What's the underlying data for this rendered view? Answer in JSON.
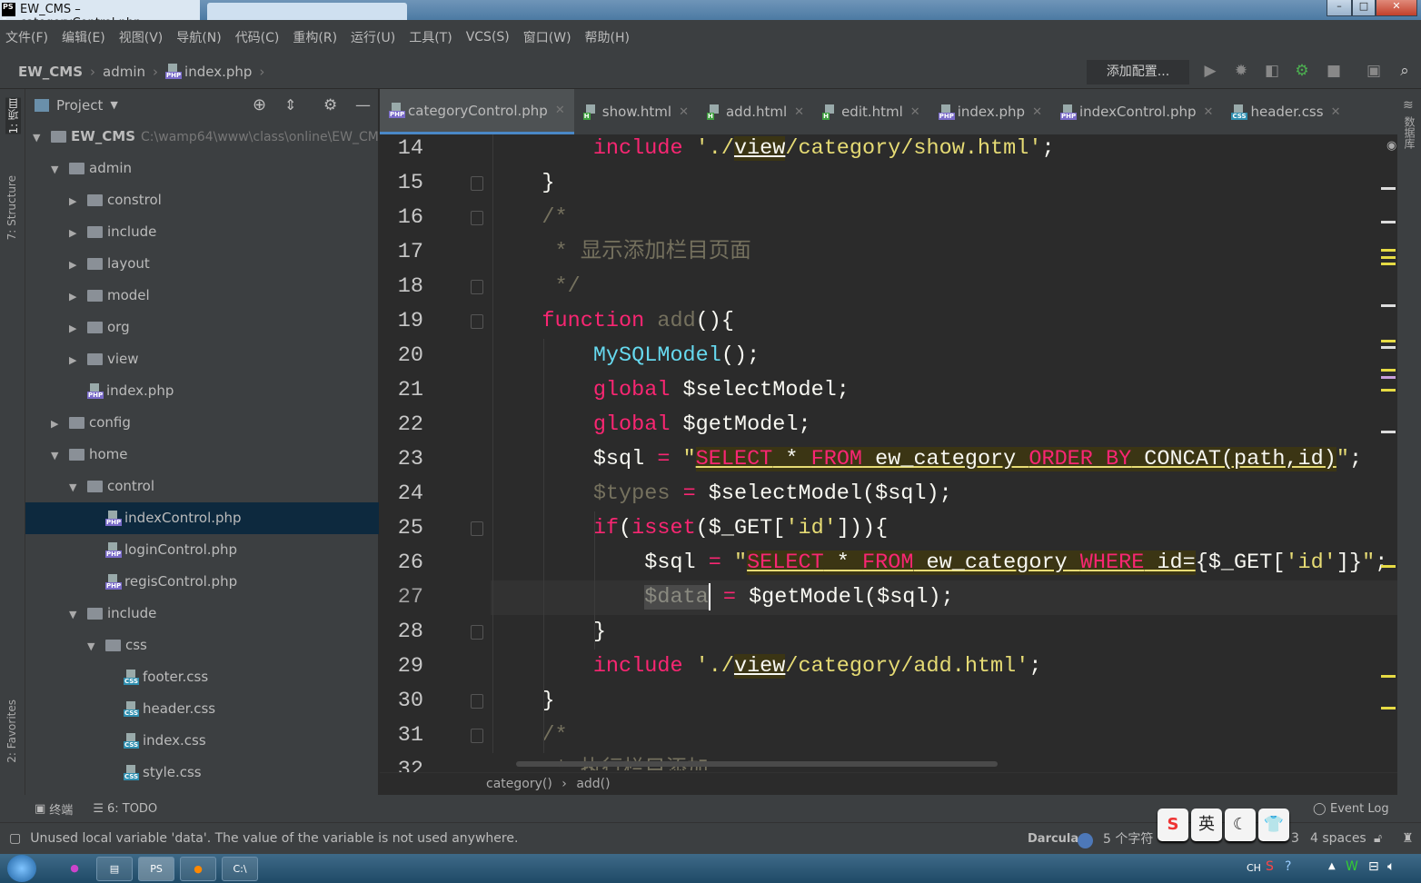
{
  "window": {
    "title": "EW_CMS – categoryControl.php",
    "controls": [
      "–",
      "□",
      "✕"
    ]
  },
  "menu": [
    "文件(F)",
    "编辑(E)",
    "视图(V)",
    "导航(N)",
    "代码(C)",
    "重构(R)",
    "运行(U)",
    "工具(T)",
    "VCS(S)",
    "窗口(W)",
    "帮助(H)"
  ],
  "breadcrumb": {
    "project": "EW_CMS",
    "folder": "admin",
    "file": "index.php"
  },
  "toolbar": {
    "run_config": "添加配置...",
    "icons": [
      "run-icon",
      "debug-icon",
      "coverage-icon",
      "profiler-icon",
      "stop-icon",
      "terminal-icon",
      "search-icon"
    ]
  },
  "left_stripe": {
    "project": "1: 项目",
    "structure": "7: Structure",
    "favorites": "2: Favorites"
  },
  "right_stripe": {
    "database": "数据库"
  },
  "project_panel": {
    "title": "Project",
    "tree": [
      {
        "name": "EW_CMS",
        "hint": "C:\\wamp64\\www\\class\\online\\EW_CM",
        "level": 0,
        "type": "folder",
        "state": "open",
        "bold": true
      },
      {
        "name": "admin",
        "level": 1,
        "type": "folder",
        "state": "open"
      },
      {
        "name": "constrol",
        "level": 2,
        "type": "folder",
        "state": "closed"
      },
      {
        "name": "include",
        "level": 2,
        "type": "folder",
        "state": "closed"
      },
      {
        "name": "layout",
        "level": 2,
        "type": "folder",
        "state": "closed"
      },
      {
        "name": "model",
        "level": 2,
        "type": "folder",
        "state": "closed"
      },
      {
        "name": "org",
        "level": 2,
        "type": "folder",
        "state": "closed"
      },
      {
        "name": "view",
        "level": 2,
        "type": "folder",
        "state": "closed"
      },
      {
        "name": "index.php",
        "level": 2,
        "type": "php"
      },
      {
        "name": "config",
        "level": 1,
        "type": "folder",
        "state": "closed"
      },
      {
        "name": "home",
        "level": 1,
        "type": "folder",
        "state": "open"
      },
      {
        "name": "control",
        "level": 2,
        "type": "folder",
        "state": "open"
      },
      {
        "name": "indexControl.php",
        "level": 3,
        "type": "php",
        "selected": true
      },
      {
        "name": "loginControl.php",
        "level": 3,
        "type": "php"
      },
      {
        "name": "regisControl.php",
        "level": 3,
        "type": "php"
      },
      {
        "name": "include",
        "level": 2,
        "type": "folder",
        "state": "open"
      },
      {
        "name": "css",
        "level": 3,
        "type": "folder",
        "state": "open"
      },
      {
        "name": "footer.css",
        "level": 4,
        "type": "css"
      },
      {
        "name": "header.css",
        "level": 4,
        "type": "css"
      },
      {
        "name": "index.css",
        "level": 4,
        "type": "css"
      },
      {
        "name": "style.css",
        "level": 4,
        "type": "css"
      }
    ]
  },
  "tabs": [
    {
      "label": "categoryControl.php",
      "type": "php",
      "active": true
    },
    {
      "label": "show.html",
      "type": "html"
    },
    {
      "label": "add.html",
      "type": "html"
    },
    {
      "label": "edit.html",
      "type": "html"
    },
    {
      "label": "index.php",
      "type": "php"
    },
    {
      "label": "indexControl.php",
      "type": "php"
    },
    {
      "label": "header.css",
      "type": "css"
    }
  ],
  "code": [
    {
      "n": "14",
      "t": [
        [
          "plain",
          "        "
        ],
        [
          "kw",
          "include"
        ],
        [
          "plain",
          " "
        ],
        [
          "str",
          "'./"
        ],
        [
          "link",
          "view"
        ],
        [
          "str",
          "/category/show.html'"
        ],
        [
          "plain",
          ";"
        ]
      ]
    },
    {
      "n": "15",
      "t": [
        [
          "plain",
          "    }"
        ]
      ]
    },
    {
      "n": "16",
      "t": [
        [
          "plain",
          "    "
        ],
        [
          "cmt",
          "/*"
        ]
      ]
    },
    {
      "n": "17",
      "t": [
        [
          "plain",
          "     "
        ],
        [
          "cmt",
          "* 显示添加栏目页面"
        ]
      ]
    },
    {
      "n": "18",
      "t": [
        [
          "plain",
          "     "
        ],
        [
          "cmt",
          "*/"
        ]
      ]
    },
    {
      "n": "19",
      "t": [
        [
          "plain",
          "    "
        ],
        [
          "kw",
          "function"
        ],
        [
          "plain",
          " "
        ],
        [
          "unused",
          "add"
        ],
        [
          "plain",
          "(){"
        ]
      ]
    },
    {
      "n": "20",
      "t": [
        [
          "plain",
          "        "
        ],
        [
          "fn",
          "MySQLModel"
        ],
        [
          "plain",
          "();"
        ]
      ]
    },
    {
      "n": "21",
      "t": [
        [
          "plain",
          "        "
        ],
        [
          "kw",
          "global"
        ],
        [
          "plain",
          " $selectModel;"
        ]
      ]
    },
    {
      "n": "22",
      "t": [
        [
          "plain",
          "        "
        ],
        [
          "kw",
          "global"
        ],
        [
          "plain",
          " $getModel;"
        ]
      ]
    },
    {
      "n": "23",
      "t": [
        [
          "plain",
          "        $sql "
        ],
        [
          "kw",
          "="
        ],
        [
          "plain",
          " "
        ],
        [
          "str",
          "\""
        ],
        [
          "sqlkw",
          "SELECT"
        ],
        [
          "sql",
          " * "
        ],
        [
          "sqlkw",
          "FROM"
        ],
        [
          "sql",
          " ew_category "
        ],
        [
          "sqlkw",
          "ORDER BY"
        ],
        [
          "sql",
          " CONCAT(path,id)"
        ],
        [
          "str",
          "\""
        ],
        [
          "plain",
          ";"
        ]
      ]
    },
    {
      "n": "24",
      "t": [
        [
          "plain",
          "        "
        ],
        [
          "unused",
          "$types"
        ],
        [
          "plain",
          " "
        ],
        [
          "kw",
          "="
        ],
        [
          "plain",
          " $selectModel($sql);"
        ]
      ]
    },
    {
      "n": "25",
      "t": [
        [
          "plain",
          "        "
        ],
        [
          "kw",
          "if"
        ],
        [
          "plain",
          "("
        ],
        [
          "kw",
          "isset"
        ],
        [
          "plain",
          "($_GET["
        ],
        [
          "str",
          "'id'"
        ],
        [
          "plain",
          "])){"
        ]
      ]
    },
    {
      "n": "26",
      "t": [
        [
          "plain",
          "            $sql "
        ],
        [
          "kw",
          "="
        ],
        [
          "plain",
          " "
        ],
        [
          "str",
          "\""
        ],
        [
          "sqlkw",
          "SELECT"
        ],
        [
          "sql",
          " * "
        ],
        [
          "sqlkw",
          "FROM"
        ],
        [
          "sql",
          " ew_category "
        ],
        [
          "sqlkw",
          "WHERE"
        ],
        [
          "sql",
          " id="
        ],
        [
          "plain",
          "{$_GET["
        ],
        [
          "str",
          "'id'"
        ],
        [
          "plain",
          "]}"
        ],
        [
          "str",
          "\""
        ],
        [
          "plain",
          ";"
        ]
      ]
    },
    {
      "n": "27",
      "cur": true,
      "t": [
        [
          "plain",
          "            "
        ],
        [
          "sel",
          "$data"
        ],
        [
          "cursor",
          ""
        ],
        [
          "plain",
          " "
        ],
        [
          "kw",
          "="
        ],
        [
          "plain",
          " $getModel($sql);"
        ]
      ]
    },
    {
      "n": "28",
      "t": [
        [
          "plain",
          "        }"
        ]
      ]
    },
    {
      "n": "29",
      "t": [
        [
          "plain",
          "        "
        ],
        [
          "kw",
          "include"
        ],
        [
          "plain",
          " "
        ],
        [
          "str",
          "'./"
        ],
        [
          "link",
          "view"
        ],
        [
          "str",
          "/category/add.html'"
        ],
        [
          "plain",
          ";"
        ]
      ]
    },
    {
      "n": "30",
      "t": [
        [
          "plain",
          "    }"
        ]
      ]
    },
    {
      "n": "31",
      "t": [
        [
          "plain",
          "    "
        ],
        [
          "cmt",
          "/*"
        ]
      ]
    },
    {
      "n": "32",
      "t": [
        [
          "plain",
          "     "
        ],
        [
          "cmt",
          "* 执行栏目添加"
        ]
      ]
    }
  ],
  "editor_breadcrumb": [
    "category()",
    "add()"
  ],
  "bottom_tools": {
    "terminal": "终端",
    "todo": "6: TODO",
    "event_log": "Event Log"
  },
  "status": {
    "message": "Unused local variable 'data'. The value of the variable is not used anywhere.",
    "theme": "Darcula",
    "chars": "5 个字符",
    "position_fragment": "3",
    "indent": "4 spaces"
  },
  "ime": [
    "S",
    "英",
    "☾",
    "👕"
  ],
  "tray": {
    "lang": "CH"
  },
  "colors": {
    "keyword": "#f92672",
    "string": "#e6db74",
    "comment": "#75715e",
    "function": "#66d9ef",
    "selection": "#0d293e",
    "accent": "#4a88c7"
  }
}
